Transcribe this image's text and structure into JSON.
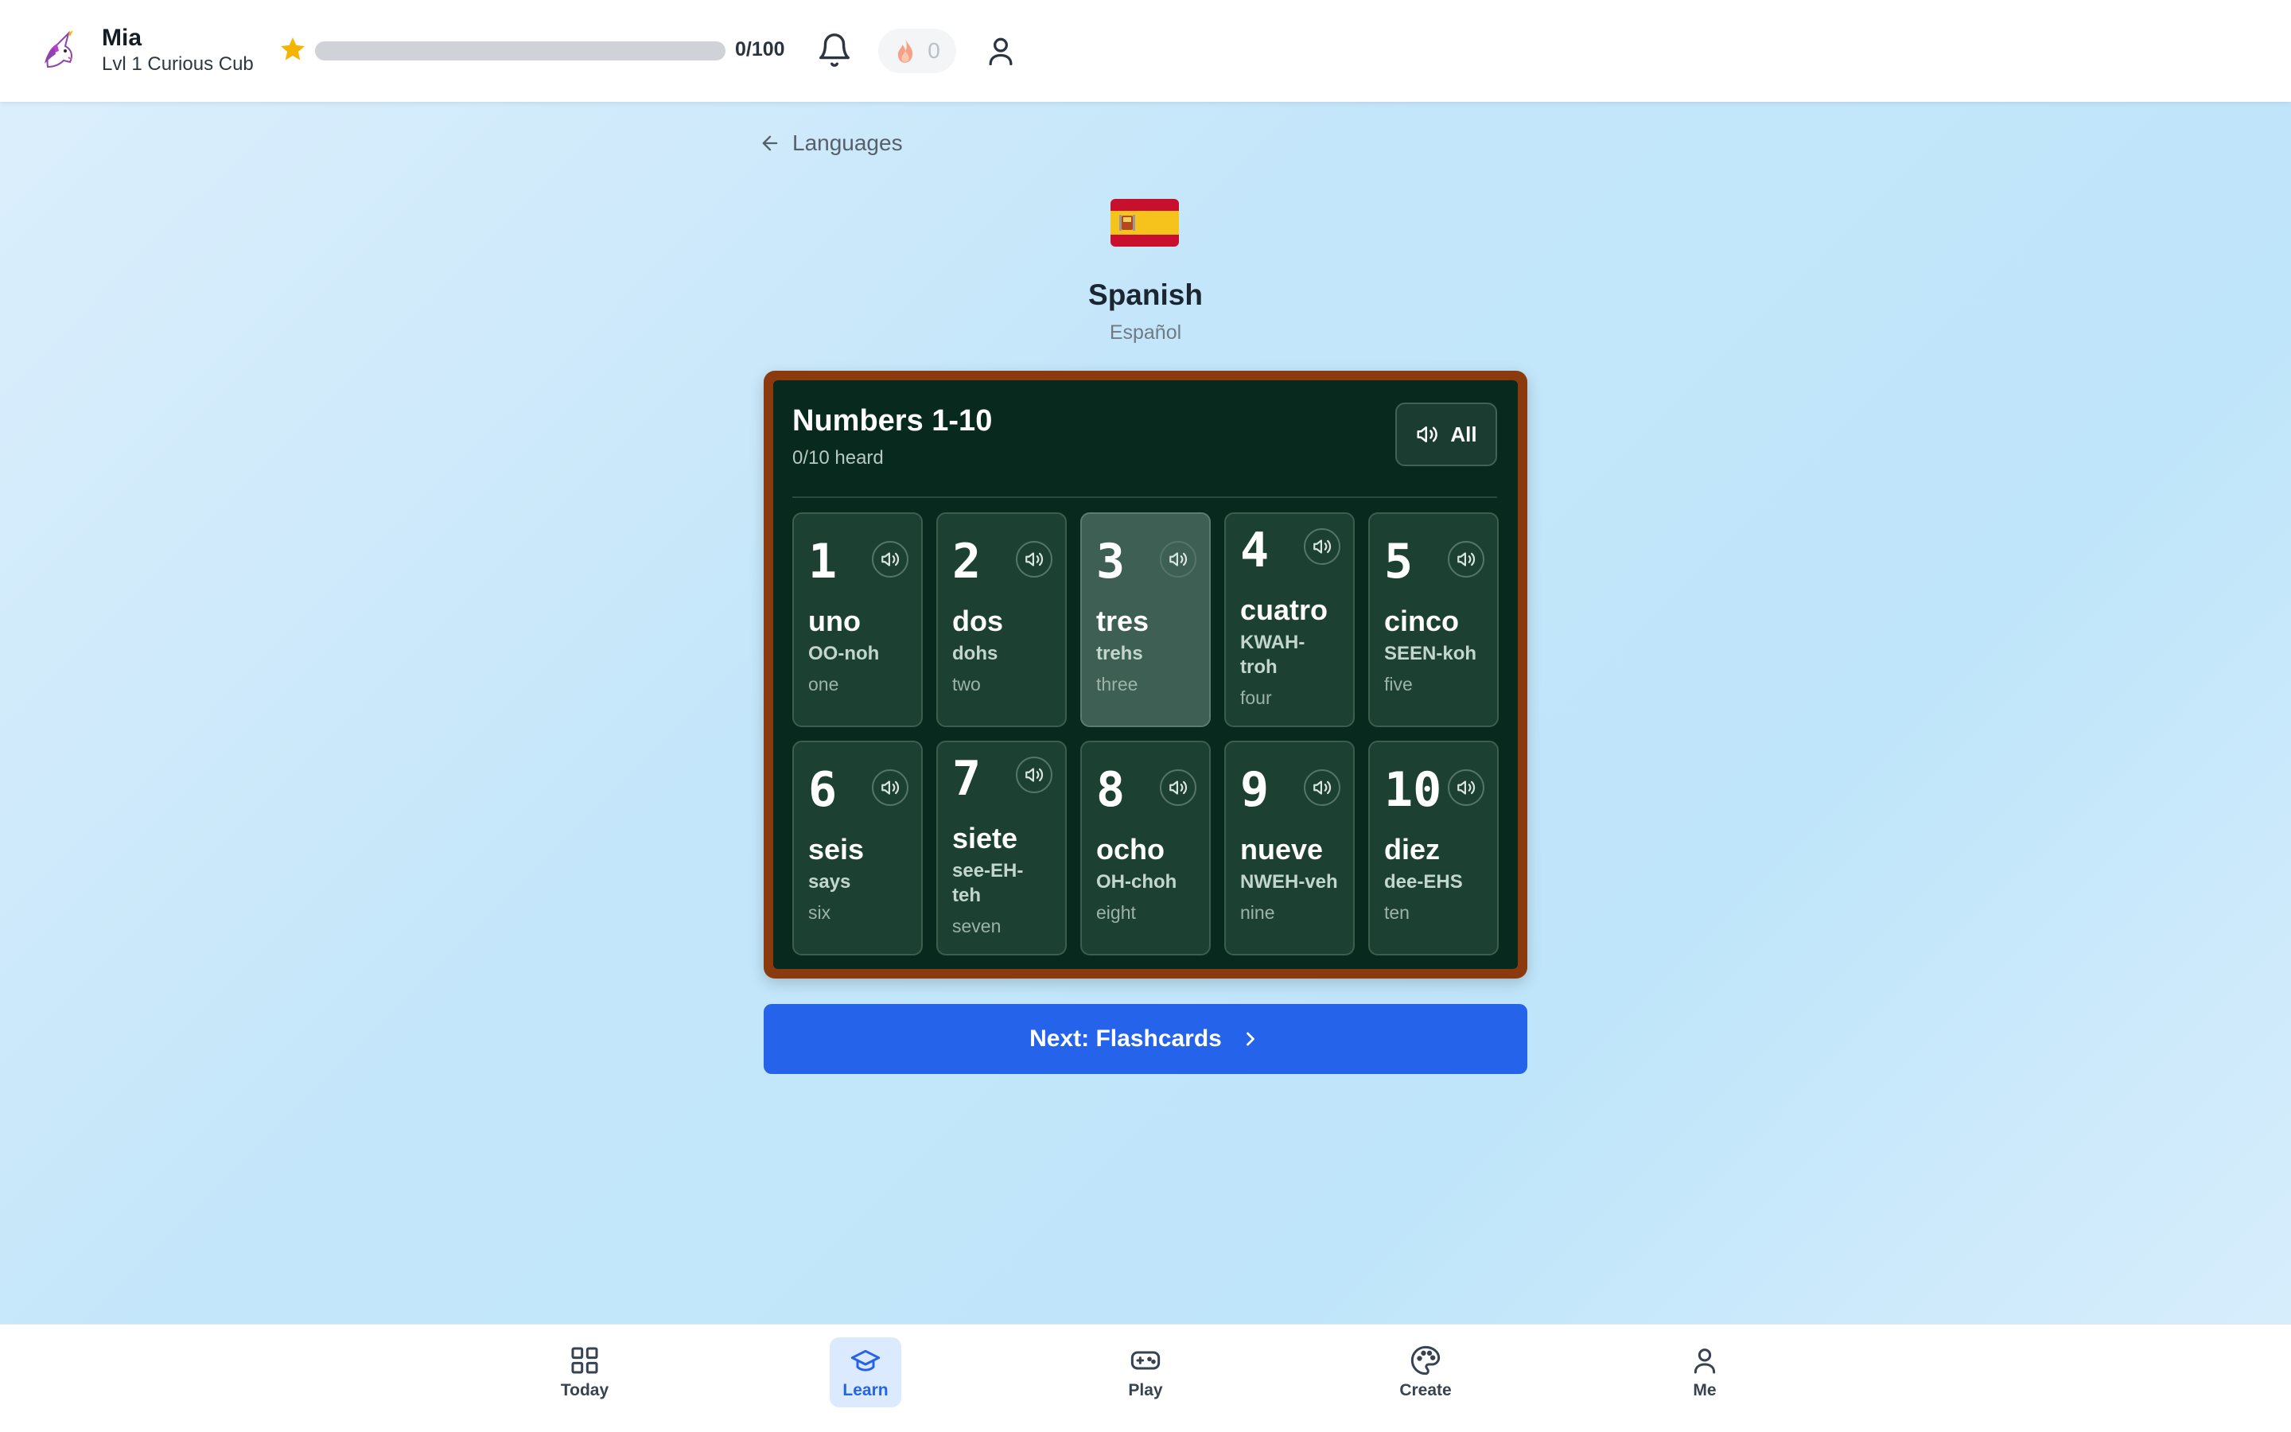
{
  "header": {
    "user_name": "Mia",
    "user_level": "Lvl 1 Curious Cub",
    "xp_text": "0/100",
    "xp_progress": 0,
    "streak_count": "0"
  },
  "nav": {
    "back_label": "Languages"
  },
  "language": {
    "title": "Spanish",
    "native": "Español"
  },
  "lesson": {
    "title": "Numbers 1-10",
    "progress": "0/10 heard",
    "play_all_label": "All",
    "cards": [
      {
        "num": "1",
        "word": "uno",
        "phonetic": "OO-noh",
        "translation": "one"
      },
      {
        "num": "2",
        "word": "dos",
        "phonetic": "dohs",
        "translation": "two"
      },
      {
        "num": "3",
        "word": "tres",
        "phonetic": "trehs",
        "translation": "three"
      },
      {
        "num": "4",
        "word": "cuatro",
        "phonetic": "KWAH-troh",
        "translation": "four"
      },
      {
        "num": "5",
        "word": "cinco",
        "phonetic": "SEEN-koh",
        "translation": "five"
      },
      {
        "num": "6",
        "word": "seis",
        "phonetic": "says",
        "translation": "six"
      },
      {
        "num": "7",
        "word": "siete",
        "phonetic": "see-EH-teh",
        "translation": "seven"
      },
      {
        "num": "8",
        "word": "ocho",
        "phonetic": "OH-choh",
        "translation": "eight"
      },
      {
        "num": "9",
        "word": "nueve",
        "phonetic": "NWEH-veh",
        "translation": "nine"
      },
      {
        "num": "10",
        "word": "diez",
        "phonetic": "dee-EHS",
        "translation": "ten"
      }
    ],
    "next_label": "Next: Flashcards"
  },
  "bottom_nav": {
    "items": [
      {
        "label": "Today",
        "icon": "grid-icon"
      },
      {
        "label": "Learn",
        "icon": "graduation-cap-icon"
      },
      {
        "label": "Play",
        "icon": "gamepad-icon"
      },
      {
        "label": "Create",
        "icon": "palette-icon"
      },
      {
        "label": "Me",
        "icon": "user-icon"
      }
    ],
    "active": "Learn"
  },
  "colors": {
    "accent": "#2563eb",
    "board_frame": "#8a3a0c",
    "board": "#07291e",
    "card": "#1c4032"
  }
}
